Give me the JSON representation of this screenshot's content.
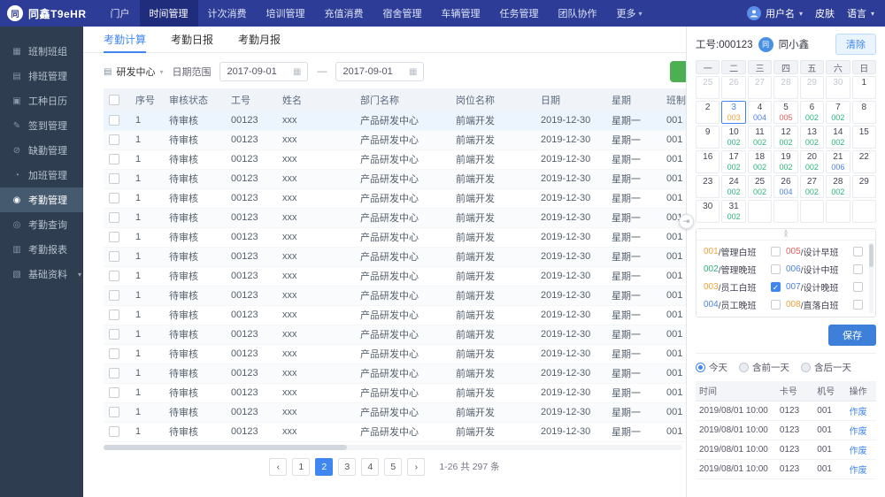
{
  "colors": {
    "accent": "#4086f0",
    "nav_bg": "#2d3c96",
    "nav_active_bg": "#202d7d",
    "sidebar_bg": "#2e3d4f",
    "green_button": "#4cb052",
    "save_button": "#3d7fd9",
    "shift_green": "#2db57a",
    "shift_orange": "#f0a23c",
    "shift_blue": "#4f81e8",
    "shift_red": "#e65c5c"
  },
  "icons": {
    "caret_down": "▾",
    "calendar": "▦",
    "dept": "▤",
    "collapse_up": "∧",
    "panel_toggle": "⇥",
    "check": "✓",
    "prev": "‹",
    "next": "›"
  },
  "topnav": {
    "logo_mark": "同",
    "logo_text": "同鑫T9eHR",
    "items": [
      {
        "label": "门户"
      },
      {
        "label": "时间管理",
        "active": true
      },
      {
        "label": "计次消费"
      },
      {
        "label": "培训管理"
      },
      {
        "label": "充值消费"
      },
      {
        "label": "宿舍管理"
      },
      {
        "label": "车辆管理"
      },
      {
        "label": "任务管理"
      },
      {
        "label": "团队协作"
      },
      {
        "label": "更多",
        "caret": true
      }
    ],
    "right": {
      "user": "用户名",
      "skin": "皮肤",
      "lang": "语言"
    }
  },
  "sidebar": {
    "items": [
      {
        "label": "班制班组",
        "icon": "▦",
        "icon_name": "shift-group-icon"
      },
      {
        "label": "排班管理",
        "icon": "▤",
        "icon_name": "schedule-icon"
      },
      {
        "label": "工种日历",
        "icon": "▣",
        "icon_name": "calendar-icon"
      },
      {
        "label": "签到管理",
        "icon": "✎",
        "icon_name": "signin-icon"
      },
      {
        "label": "缺勤管理",
        "icon": "⊘",
        "icon_name": "absence-icon"
      },
      {
        "label": "加班管理",
        "icon": "◔",
        "icon_name": "overtime-icon"
      },
      {
        "label": "考勤管理",
        "icon": "◉",
        "icon_name": "attendance-icon",
        "active": true
      },
      {
        "label": "考勤查询",
        "icon": "◎",
        "icon_name": "attendance-query-icon"
      },
      {
        "label": "考勤报表",
        "icon": "▥",
        "icon_name": "report-icon"
      },
      {
        "label": "基础资料",
        "icon": "▧",
        "icon_name": "base-data-icon",
        "caret": true
      }
    ]
  },
  "main": {
    "tabs": [
      {
        "label": "考勤计算",
        "active": true
      },
      {
        "label": "考勤日报"
      },
      {
        "label": "考勤月报"
      }
    ],
    "filters": {
      "dept": "研发中心",
      "date_label": "日期范围",
      "date_from": "2017-09-01",
      "range_sep": "—",
      "date_to": "2017-09-01"
    },
    "table": {
      "columns": [
        "序号",
        "审核状态",
        "工号",
        "姓名",
        "部门名称",
        "岗位名称",
        "日期",
        "星期",
        "班制编号"
      ],
      "rows": [
        {
          "cells": [
            "1",
            "待审核",
            "00123",
            "xxx",
            "产品研发中心",
            "前端开发",
            "2019-12-30",
            "星期一",
            "001"
          ]
        },
        {
          "cells": [
            "1",
            "待审核",
            "00123",
            "xxx",
            "产品研发中心",
            "前端开发",
            "2019-12-30",
            "星期一",
            "001"
          ]
        },
        {
          "cells": [
            "1",
            "待审核",
            "00123",
            "xxx",
            "产品研发中心",
            "前端开发",
            "2019-12-30",
            "星期一",
            "001"
          ]
        },
        {
          "cells": [
            "1",
            "待审核",
            "00123",
            "xxx",
            "产品研发中心",
            "前端开发",
            "2019-12-30",
            "星期一",
            "001"
          ]
        },
        {
          "cells": [
            "1",
            "待审核",
            "00123",
            "xxx",
            "产品研发中心",
            "前端开发",
            "2019-12-30",
            "星期一",
            "001"
          ]
        },
        {
          "cells": [
            "1",
            "待审核",
            "00123",
            "xxx",
            "产品研发中心",
            "前端开发",
            "2019-12-30",
            "星期一",
            "001"
          ]
        },
        {
          "cells": [
            "1",
            "待审核",
            "00123",
            "xxx",
            "产品研发中心",
            "前端开发",
            "2019-12-30",
            "星期一",
            "001"
          ]
        },
        {
          "cells": [
            "1",
            "待审核",
            "00123",
            "xxx",
            "产品研发中心",
            "前端开发",
            "2019-12-30",
            "星期一",
            "001"
          ]
        },
        {
          "cells": [
            "1",
            "待审核",
            "00123",
            "xxx",
            "产品研发中心",
            "前端开发",
            "2019-12-30",
            "星期一",
            "001"
          ]
        },
        {
          "cells": [
            "1",
            "待审核",
            "00123",
            "xxx",
            "产品研发中心",
            "前端开发",
            "2019-12-30",
            "星期一",
            "001"
          ]
        },
        {
          "cells": [
            "1",
            "待审核",
            "00123",
            "xxx",
            "产品研发中心",
            "前端开发",
            "2019-12-30",
            "星期一",
            "001"
          ]
        },
        {
          "cells": [
            "1",
            "待审核",
            "00123",
            "xxx",
            "产品研发中心",
            "前端开发",
            "2019-12-30",
            "星期一",
            "001"
          ]
        },
        {
          "cells": [
            "1",
            "待审核",
            "00123",
            "xxx",
            "产品研发中心",
            "前端开发",
            "2019-12-30",
            "星期一",
            "001"
          ]
        },
        {
          "cells": [
            "1",
            "待审核",
            "00123",
            "xxx",
            "产品研发中心",
            "前端开发",
            "2019-12-30",
            "星期一",
            "001"
          ]
        },
        {
          "cells": [
            "1",
            "待审核",
            "00123",
            "xxx",
            "产品研发中心",
            "前端开发",
            "2019-12-30",
            "星期一",
            "001"
          ]
        },
        {
          "cells": [
            "1",
            "待审核",
            "00123",
            "xxx",
            "产品研发中心",
            "前端开发",
            "2019-12-30",
            "星期一",
            "001"
          ]
        },
        {
          "cells": [
            "1",
            "待审核",
            "00123",
            "xxx",
            "产品研发中心",
            "前端开发",
            "2019-12-30",
            "星期一",
            "001"
          ]
        }
      ]
    },
    "pagination": {
      "pages": [
        "1",
        "2",
        "3",
        "4",
        "5"
      ],
      "active": "2",
      "summary": "1-26 共 297 条"
    }
  },
  "panel": {
    "emp_label": "工号:000123",
    "avatar_text": "同",
    "emp_name": "同小鑫",
    "clear_btn": "清除",
    "calendar": {
      "weekdays": [
        "一",
        "二",
        "三",
        "四",
        "五",
        "六",
        "日"
      ],
      "cells": [
        {
          "day": "25",
          "muted": true
        },
        {
          "day": "26",
          "muted": true
        },
        {
          "day": "27",
          "muted": true
        },
        {
          "day": "28",
          "muted": true
        },
        {
          "day": "29",
          "muted": true
        },
        {
          "day": "30",
          "muted": true
        },
        {
          "day": "1"
        },
        {
          "day": "2"
        },
        {
          "day": "3",
          "code": "003",
          "color": "#f0a23c",
          "selected": true
        },
        {
          "day": "4",
          "code": "004",
          "color": "#4f81e8"
        },
        {
          "day": "5",
          "code": "005",
          "color": "#e65c5c"
        },
        {
          "day": "6",
          "code": "002",
          "color": "#2db57a"
        },
        {
          "day": "7",
          "code": "002",
          "color": "#2db57a"
        },
        {
          "day": "8"
        },
        {
          "day": "9"
        },
        {
          "day": "10",
          "code": "002",
          "color": "#2db57a"
        },
        {
          "day": "11",
          "code": "002",
          "color": "#2db57a"
        },
        {
          "day": "12",
          "code": "002",
          "color": "#2db57a"
        },
        {
          "day": "13",
          "code": "002",
          "color": "#2db57a"
        },
        {
          "day": "14",
          "code": "002",
          "color": "#2db57a"
        },
        {
          "day": "15"
        },
        {
          "day": "16"
        },
        {
          "day": "17",
          "code": "002",
          "color": "#2db57a"
        },
        {
          "day": "18",
          "code": "002",
          "color": "#2db57a"
        },
        {
          "day": "19",
          "code": "002",
          "color": "#2db57a"
        },
        {
          "day": "20",
          "code": "002",
          "color": "#2db57a"
        },
        {
          "day": "21",
          "code": "006",
          "color": "#4f81e8"
        },
        {
          "day": "22"
        },
        {
          "day": "23"
        },
        {
          "day": "24",
          "code": "002",
          "color": "#2db57a"
        },
        {
          "day": "25",
          "code": "002",
          "color": "#2db57a"
        },
        {
          "day": "26",
          "code": "004",
          "color": "#4f81e8"
        },
        {
          "day": "27",
          "code": "002",
          "color": "#2db57a"
        },
        {
          "day": "28",
          "code": "002",
          "color": "#2db57a"
        },
        {
          "day": "29"
        },
        {
          "day": "30"
        },
        {
          "day": "31",
          "code": "002",
          "color": "#2db57a"
        },
        {
          "day": ""
        },
        {
          "day": ""
        },
        {
          "day": ""
        },
        {
          "day": ""
        },
        {
          "day": ""
        }
      ]
    },
    "shifts": [
      {
        "code": "001",
        "name": "管理白班",
        "color": "#f0a23c",
        "checked": false
      },
      {
        "code": "005",
        "name": "设计早班",
        "color": "#e65c5c",
        "checked": false
      },
      {
        "code": "002",
        "name": "管理晚班",
        "color": "#2db57a",
        "checked": false
      },
      {
        "code": "006",
        "name": "设计中班",
        "color": "#4f81e8",
        "checked": false
      },
      {
        "code": "003",
        "name": "员工白班",
        "color": "#f0a23c",
        "checked": true
      },
      {
        "code": "007",
        "name": "设计晚班",
        "color": "#4f81e8",
        "checked": false
      },
      {
        "code": "004",
        "name": "员工晚班",
        "color": "#4f81e8",
        "checked": false
      },
      {
        "code": "008",
        "name": "直落白班",
        "color": "#f0a23c",
        "checked": false
      }
    ],
    "save_btn": "保存",
    "radios": [
      {
        "label": "今天",
        "on": true
      },
      {
        "label": "含前一天",
        "on": false
      },
      {
        "label": "含后一天",
        "on": false
      }
    ],
    "log_table": {
      "columns": [
        "时间",
        "卡号",
        "机号",
        "操作"
      ],
      "rows": [
        {
          "cells": [
            "2019/08/01 10:00",
            "0123",
            "001"
          ],
          "action": "作废"
        },
        {
          "cells": [
            "2019/08/01 10:00",
            "0123",
            "001"
          ],
          "action": "作废"
        },
        {
          "cells": [
            "2019/08/01 10:00",
            "0123",
            "001"
          ],
          "action": "作废"
        },
        {
          "cells": [
            "2019/08/01 10:00",
            "0123",
            "001"
          ],
          "action": "作废"
        }
      ]
    }
  }
}
